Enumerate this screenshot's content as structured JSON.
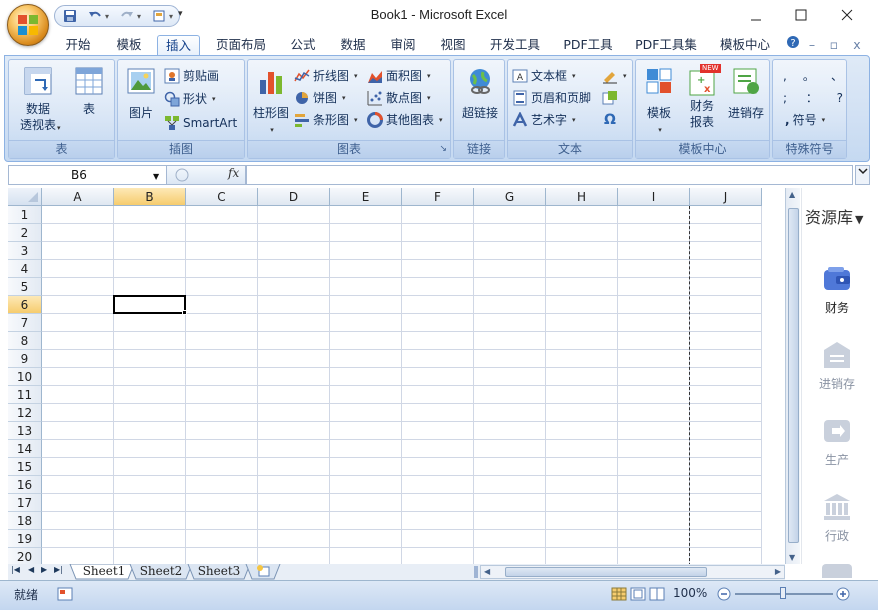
{
  "title": {
    "text": "Book1 - Microsoft Excel"
  },
  "qat": {
    "save": "save-icon",
    "undo": "undo-icon",
    "redo": "redo-icon",
    "print": "print-preview-icon",
    "more": "▾"
  },
  "window": {
    "minimize": "—",
    "maximize": "☐",
    "close": "✕"
  },
  "tabs": [
    "开始",
    "模板",
    "插入",
    "页面布局",
    "公式",
    "数据",
    "审阅",
    "视图",
    "开发工具",
    "PDF工具",
    "PDF工具集",
    "模板中心"
  ],
  "tabs_active": "插入",
  "ribbon_right": {
    "help": "?",
    "minimize": "–",
    "restore": "▫",
    "close": "x"
  },
  "ribbon": {
    "table": {
      "pivot": "数据\n透视表",
      "table": "表",
      "label": "表"
    },
    "illustrations": {
      "picture": "图片",
      "clipart": "剪贴画",
      "shapes": "形状",
      "smartart": "SmartArt",
      "label": "插图"
    },
    "charts": {
      "column": "柱形图",
      "line": "折线图",
      "pie": "饼图",
      "bar": "条形图",
      "area": "面积图",
      "scatter": "散点图",
      "other": "其他图表",
      "label": "图表"
    },
    "links": {
      "hyperlink": "超链接",
      "label": "链接"
    },
    "text": {
      "textbox": "文本框",
      "headerfooter": "页眉和页脚",
      "wordart": "艺术字",
      "label": "文本",
      "symbol": "Ω"
    },
    "template_center": {
      "template": "模板",
      "finance": "财务\n报表",
      "inventory": "进销存",
      "new_badge": "NEW",
      "label": "模板中心"
    },
    "special": {
      "row1": [
        ",",
        "。",
        "、"
      ],
      "row2": [
        ";",
        "：",
        "?"
      ],
      "symbol": "符号",
      "label": "特殊符号"
    }
  },
  "formula_bar": {
    "name_box": "B6",
    "fx": "fx",
    "formula": ""
  },
  "grid": {
    "columns": [
      "A",
      "B",
      "C",
      "D",
      "E",
      "F",
      "G",
      "H",
      "I",
      "J"
    ],
    "rows": [
      "1",
      "2",
      "3",
      "4",
      "5",
      "6",
      "7",
      "8",
      "9",
      "10",
      "11",
      "12",
      "13",
      "14",
      "15",
      "16",
      "17",
      "18",
      "19",
      "20"
    ],
    "selected_column": "B",
    "selected_row": "6"
  },
  "side_panel": {
    "title": "资源库",
    "items": [
      {
        "label": "财务",
        "icon": "wallet-icon"
      },
      {
        "label": "进销存",
        "icon": "exchange-icon"
      },
      {
        "label": "生产",
        "icon": "production-icon"
      },
      {
        "label": "行政",
        "icon": "building-icon"
      }
    ]
  },
  "sheets": [
    "Sheet1",
    "Sheet2",
    "Sheet3"
  ],
  "active_sheet": "Sheet1",
  "status": {
    "ready": "就绪",
    "zoom": "100%"
  },
  "colors": {
    "accent": "#15428b",
    "ribbon": "#d2e1f4",
    "selected_header": "#f6cc6e"
  }
}
